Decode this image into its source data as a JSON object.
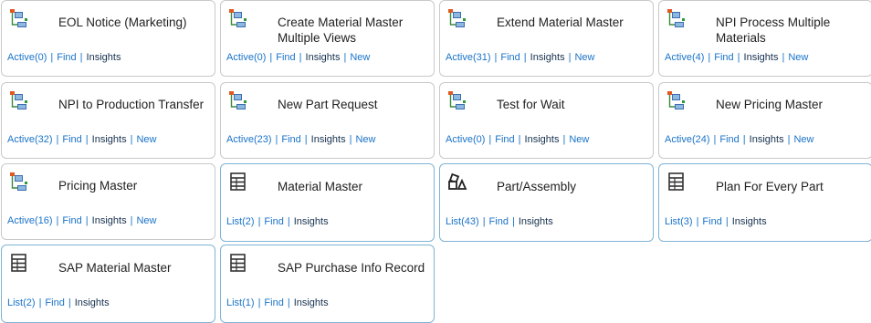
{
  "tiles": [
    {
      "title": "EOL Notice (Marketing)",
      "icon": "workflow-icon",
      "links": [
        "Active(0)",
        "Find",
        "Insights"
      ]
    },
    {
      "title": "Create Material Master Multiple Views",
      "icon": "workflow-icon",
      "links": [
        "Active(0)",
        "Find",
        "Insights",
        "New"
      ]
    },
    {
      "title": "Extend Material Master",
      "icon": "workflow-icon",
      "links": [
        "Active(31)",
        "Find",
        "Insights",
        "New"
      ]
    },
    {
      "title": "NPI Process Multiple Materials",
      "icon": "workflow-icon",
      "links": [
        "Active(4)",
        "Find",
        "Insights",
        "New"
      ]
    },
    {
      "title": "NPI to Production Transfer",
      "icon": "workflow-icon",
      "links": [
        "Active(32)",
        "Find",
        "Insights",
        "New"
      ]
    },
    {
      "title": "New Part Request",
      "icon": "workflow-icon",
      "links": [
        "Active(23)",
        "Find",
        "Insights",
        "New"
      ]
    },
    {
      "title": "Test for Wait",
      "icon": "workflow-icon",
      "links": [
        "Active(0)",
        "Find",
        "Insights",
        "New"
      ]
    },
    {
      "title": "New Pricing Master",
      "icon": "workflow-icon",
      "links": [
        "Active(24)",
        "Find",
        "Insights",
        "New"
      ]
    },
    {
      "title": "Pricing Master",
      "icon": "workflow-icon",
      "links": [
        "Active(16)",
        "Find",
        "Insights",
        "New"
      ]
    },
    {
      "title": "Material Master",
      "icon": "table-icon",
      "links": [
        "List(2)",
        "Find",
        "Insights"
      ]
    },
    {
      "title": "Part/Assembly",
      "icon": "assembly-icon",
      "links": [
        "List(43)",
        "Find",
        "Insights"
      ]
    },
    {
      "title": "Plan For Every Part",
      "icon": "table-icon",
      "links": [
        "List(3)",
        "Find",
        "Insights"
      ]
    },
    {
      "title": "SAP Material Master",
      "icon": "table-icon",
      "links": [
        "List(2)",
        "Find",
        "Insights"
      ]
    },
    {
      "title": "SAP Purchase Info Record",
      "icon": "table-icon",
      "links": [
        "List(1)",
        "Find",
        "Insights"
      ]
    }
  ]
}
